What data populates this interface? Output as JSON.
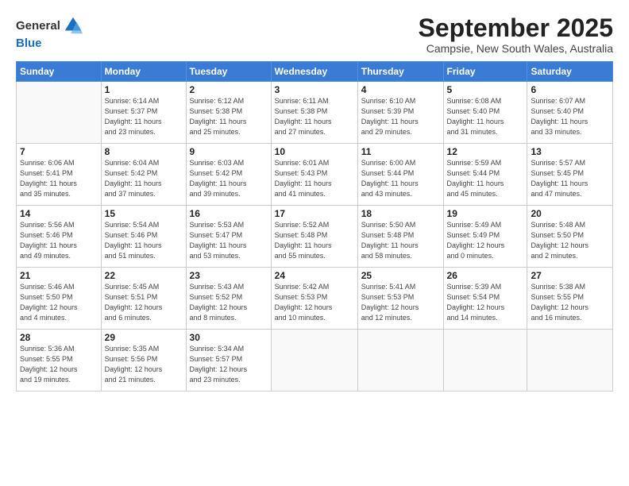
{
  "header": {
    "logo_line1": "General",
    "logo_line2": "Blue",
    "month": "September 2025",
    "location": "Campsie, New South Wales, Australia"
  },
  "weekdays": [
    "Sunday",
    "Monday",
    "Tuesday",
    "Wednesday",
    "Thursday",
    "Friday",
    "Saturday"
  ],
  "weeks": [
    [
      {
        "day": "",
        "info": ""
      },
      {
        "day": "1",
        "info": "Sunrise: 6:14 AM\nSunset: 5:37 PM\nDaylight: 11 hours\nand 23 minutes."
      },
      {
        "day": "2",
        "info": "Sunrise: 6:12 AM\nSunset: 5:38 PM\nDaylight: 11 hours\nand 25 minutes."
      },
      {
        "day": "3",
        "info": "Sunrise: 6:11 AM\nSunset: 5:38 PM\nDaylight: 11 hours\nand 27 minutes."
      },
      {
        "day": "4",
        "info": "Sunrise: 6:10 AM\nSunset: 5:39 PM\nDaylight: 11 hours\nand 29 minutes."
      },
      {
        "day": "5",
        "info": "Sunrise: 6:08 AM\nSunset: 5:40 PM\nDaylight: 11 hours\nand 31 minutes."
      },
      {
        "day": "6",
        "info": "Sunrise: 6:07 AM\nSunset: 5:40 PM\nDaylight: 11 hours\nand 33 minutes."
      }
    ],
    [
      {
        "day": "7",
        "info": "Sunrise: 6:06 AM\nSunset: 5:41 PM\nDaylight: 11 hours\nand 35 minutes."
      },
      {
        "day": "8",
        "info": "Sunrise: 6:04 AM\nSunset: 5:42 PM\nDaylight: 11 hours\nand 37 minutes."
      },
      {
        "day": "9",
        "info": "Sunrise: 6:03 AM\nSunset: 5:42 PM\nDaylight: 11 hours\nand 39 minutes."
      },
      {
        "day": "10",
        "info": "Sunrise: 6:01 AM\nSunset: 5:43 PM\nDaylight: 11 hours\nand 41 minutes."
      },
      {
        "day": "11",
        "info": "Sunrise: 6:00 AM\nSunset: 5:44 PM\nDaylight: 11 hours\nand 43 minutes."
      },
      {
        "day": "12",
        "info": "Sunrise: 5:59 AM\nSunset: 5:44 PM\nDaylight: 11 hours\nand 45 minutes."
      },
      {
        "day": "13",
        "info": "Sunrise: 5:57 AM\nSunset: 5:45 PM\nDaylight: 11 hours\nand 47 minutes."
      }
    ],
    [
      {
        "day": "14",
        "info": "Sunrise: 5:56 AM\nSunset: 5:46 PM\nDaylight: 11 hours\nand 49 minutes."
      },
      {
        "day": "15",
        "info": "Sunrise: 5:54 AM\nSunset: 5:46 PM\nDaylight: 11 hours\nand 51 minutes."
      },
      {
        "day": "16",
        "info": "Sunrise: 5:53 AM\nSunset: 5:47 PM\nDaylight: 11 hours\nand 53 minutes."
      },
      {
        "day": "17",
        "info": "Sunrise: 5:52 AM\nSunset: 5:48 PM\nDaylight: 11 hours\nand 55 minutes."
      },
      {
        "day": "18",
        "info": "Sunrise: 5:50 AM\nSunset: 5:48 PM\nDaylight: 11 hours\nand 58 minutes."
      },
      {
        "day": "19",
        "info": "Sunrise: 5:49 AM\nSunset: 5:49 PM\nDaylight: 12 hours\nand 0 minutes."
      },
      {
        "day": "20",
        "info": "Sunrise: 5:48 AM\nSunset: 5:50 PM\nDaylight: 12 hours\nand 2 minutes."
      }
    ],
    [
      {
        "day": "21",
        "info": "Sunrise: 5:46 AM\nSunset: 5:50 PM\nDaylight: 12 hours\nand 4 minutes."
      },
      {
        "day": "22",
        "info": "Sunrise: 5:45 AM\nSunset: 5:51 PM\nDaylight: 12 hours\nand 6 minutes."
      },
      {
        "day": "23",
        "info": "Sunrise: 5:43 AM\nSunset: 5:52 PM\nDaylight: 12 hours\nand 8 minutes."
      },
      {
        "day": "24",
        "info": "Sunrise: 5:42 AM\nSunset: 5:53 PM\nDaylight: 12 hours\nand 10 minutes."
      },
      {
        "day": "25",
        "info": "Sunrise: 5:41 AM\nSunset: 5:53 PM\nDaylight: 12 hours\nand 12 minutes."
      },
      {
        "day": "26",
        "info": "Sunrise: 5:39 AM\nSunset: 5:54 PM\nDaylight: 12 hours\nand 14 minutes."
      },
      {
        "day": "27",
        "info": "Sunrise: 5:38 AM\nSunset: 5:55 PM\nDaylight: 12 hours\nand 16 minutes."
      }
    ],
    [
      {
        "day": "28",
        "info": "Sunrise: 5:36 AM\nSunset: 5:55 PM\nDaylight: 12 hours\nand 19 minutes."
      },
      {
        "day": "29",
        "info": "Sunrise: 5:35 AM\nSunset: 5:56 PM\nDaylight: 12 hours\nand 21 minutes."
      },
      {
        "day": "30",
        "info": "Sunrise: 5:34 AM\nSunset: 5:57 PM\nDaylight: 12 hours\nand 23 minutes."
      },
      {
        "day": "",
        "info": ""
      },
      {
        "day": "",
        "info": ""
      },
      {
        "day": "",
        "info": ""
      },
      {
        "day": "",
        "info": ""
      }
    ]
  ]
}
